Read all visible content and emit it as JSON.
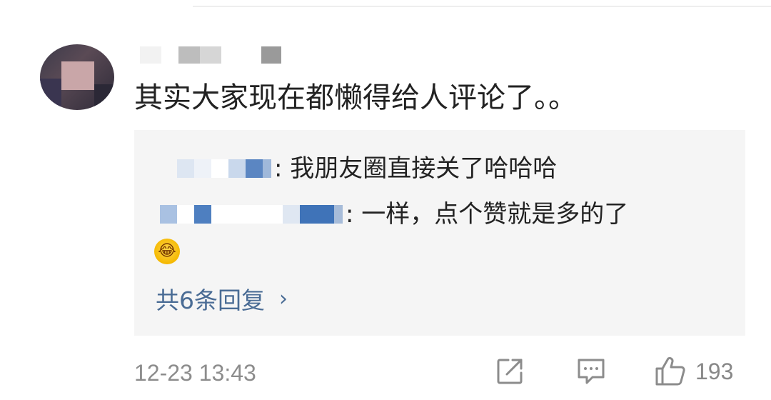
{
  "comment": {
    "text": "其实大家现在都懒得给人评论了。。",
    "timestamp": "12-23 13:43",
    "like_count": "193"
  },
  "replies": [
    {
      "text": ": 我朋友圈直接关了哈哈哈"
    },
    {
      "text": ": 一样，点个赞就是多的了"
    }
  ],
  "reply_emoji": "😂",
  "more_replies_label": "共6条回复",
  "chevron": "›",
  "icons": {
    "share": "share-icon",
    "comment": "comment-icon",
    "like": "thumbs-up-icon"
  },
  "colors": {
    "link": "#4a6c95",
    "meta_text": "#8c8c8c",
    "reply_background": "#f5f5f5"
  }
}
